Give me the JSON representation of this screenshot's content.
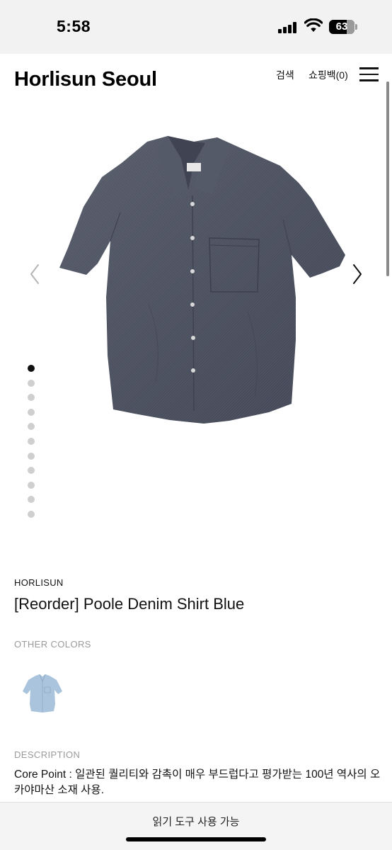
{
  "status_bar": {
    "time": "5:58",
    "battery": "63"
  },
  "header": {
    "logo": "Horlisun Seoul",
    "search_label": "검색",
    "cart_label": "쇼핑백(0)",
    "menu_icon": "hamburger-menu-icon"
  },
  "gallery": {
    "image": "dark-denim-short-sleeve-shirt",
    "prev_icon": "chevron-left-icon",
    "next_icon": "chevron-right-icon",
    "slide_count": 11,
    "active_index": 0
  },
  "product": {
    "brand": "HORLISUN",
    "title": "[Reorder] Poole Denim Shirt Blue",
    "other_colors_label": "OTHER COLORS",
    "other_colors": [
      {
        "name": "light-blue-shirt-swatch",
        "color": "#a9c4dc"
      }
    ],
    "description_label": "DESCRIPTION",
    "description_text": "Core Point : 일관된 퀄리티와 감촉이 매우 부드럽다고 평가받는 100년 역사의 오카야마산 소재 사용."
  },
  "bottom_bar": {
    "reader_label": "읽기 도구 사용 가능"
  },
  "colors": {
    "shirt": "#4e5360",
    "swatch": "#a9c4dc",
    "active_dot": "#111111",
    "inactive_dot": "#cfcfcf"
  }
}
